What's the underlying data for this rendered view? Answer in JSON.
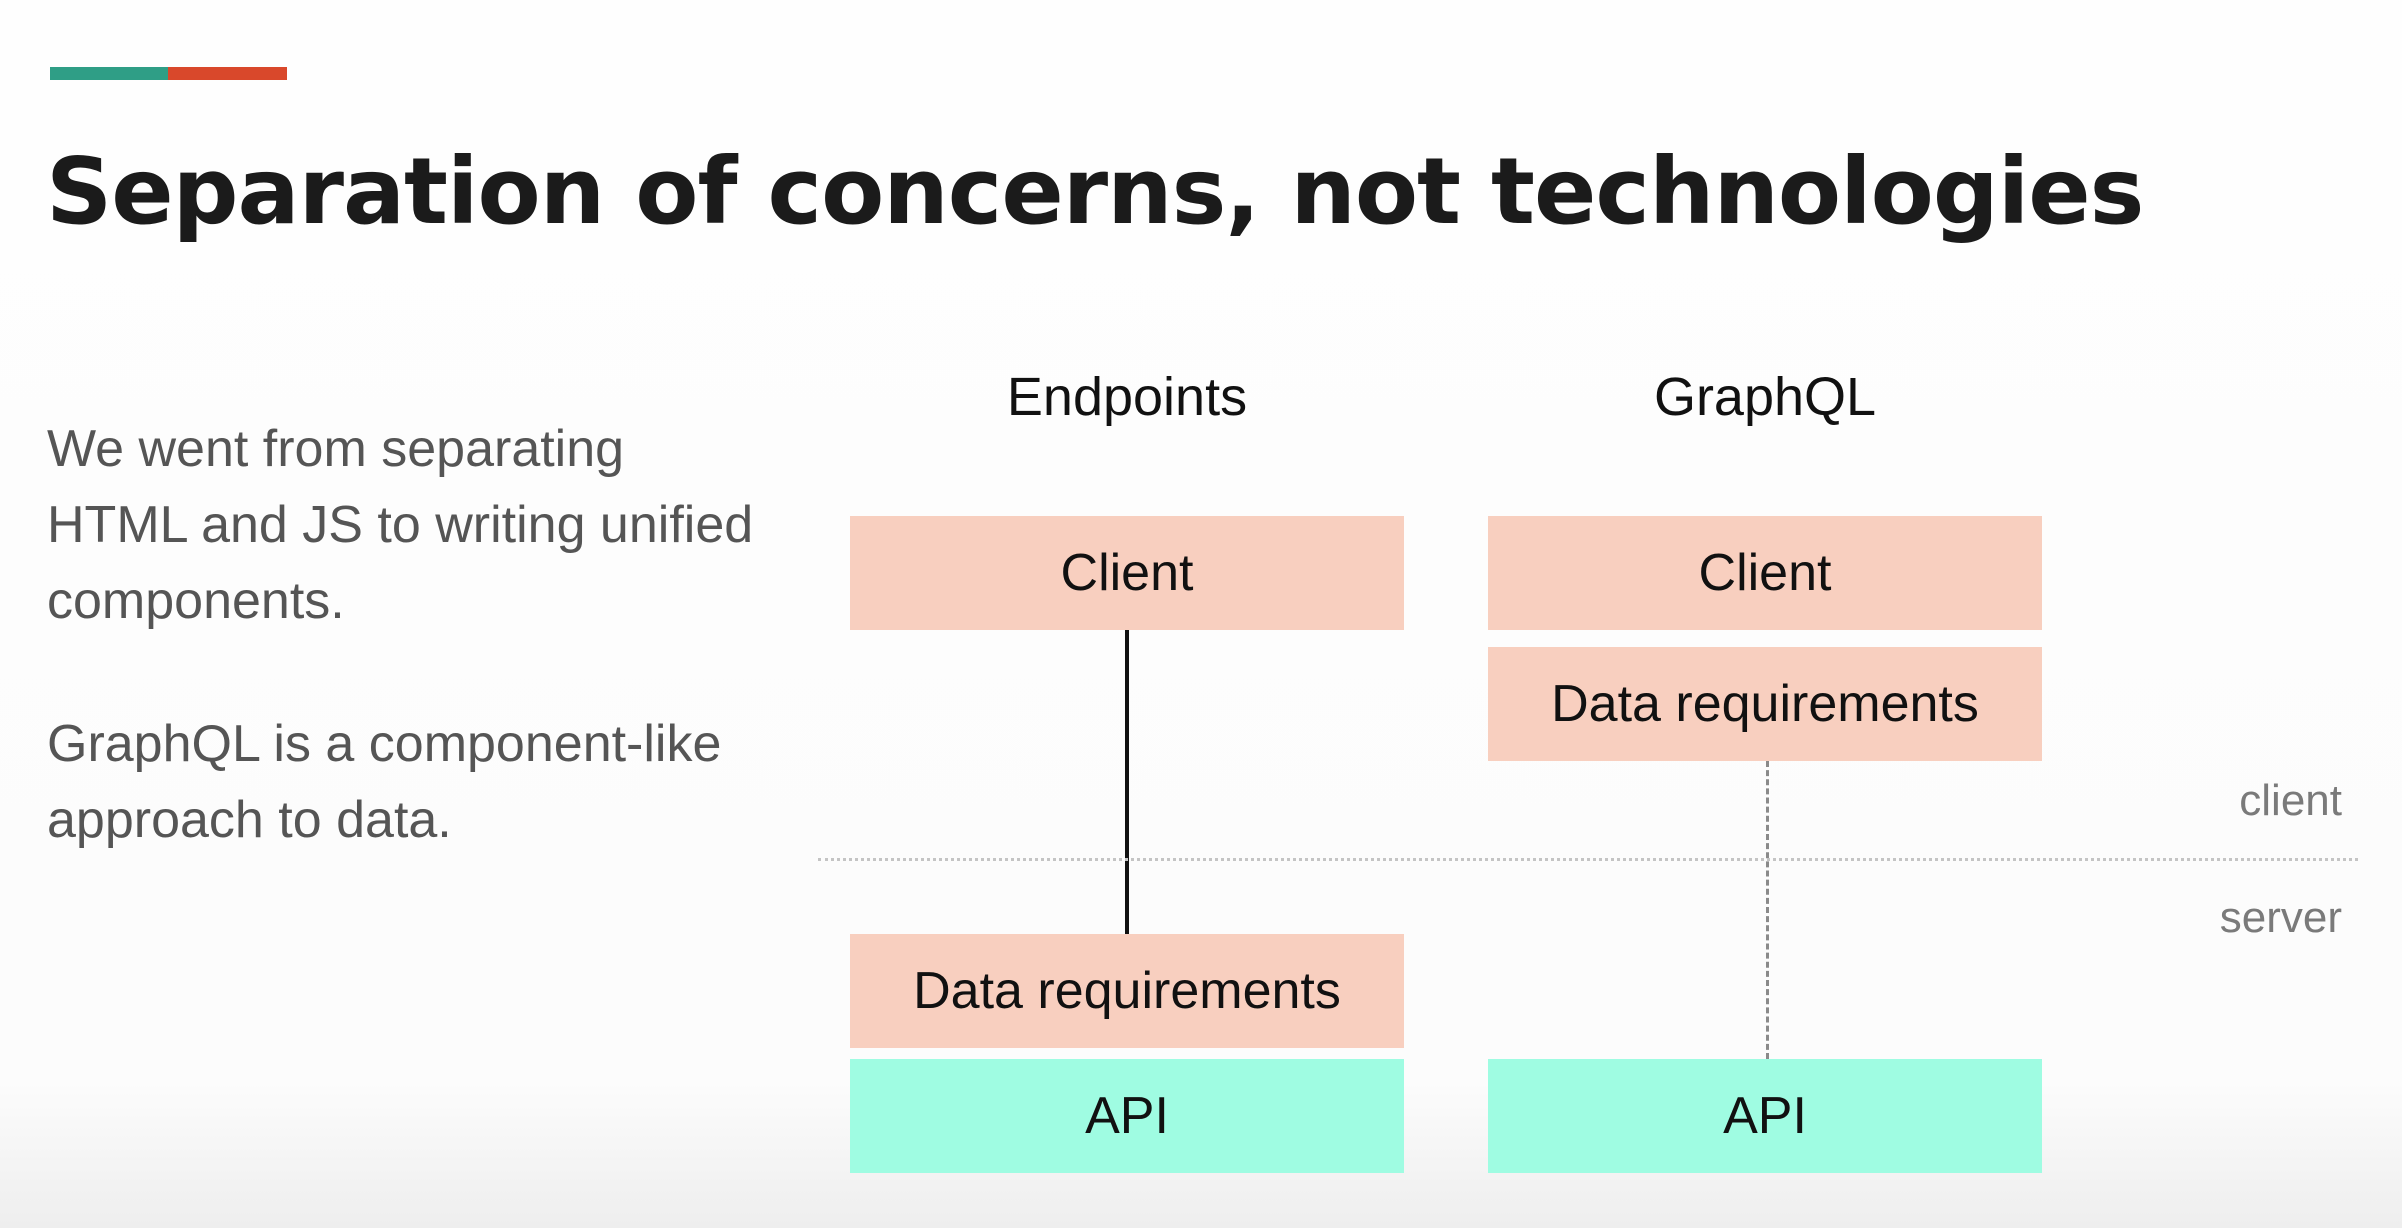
{
  "colors": {
    "accent_teal": "#2f9e86",
    "accent_orange": "#d9482b",
    "box_peach": "#f8cfbf",
    "box_mint": "#9ffce2"
  },
  "slide": {
    "title": "Separation of concerns, not technologies",
    "bullets": [
      "We went from separating HTML and JS to writing unified components.",
      "GraphQL is a component-like approach to data."
    ]
  },
  "diagram": {
    "columns": [
      {
        "header": "Endpoints",
        "client_box": "Client",
        "data_box": "Data requirements",
        "api_box": "API"
      },
      {
        "header": "GraphQL",
        "client_box": "Client",
        "data_box": "Data requirements",
        "api_box": "API"
      }
    ],
    "regions": {
      "client": "client",
      "server": "server"
    }
  }
}
